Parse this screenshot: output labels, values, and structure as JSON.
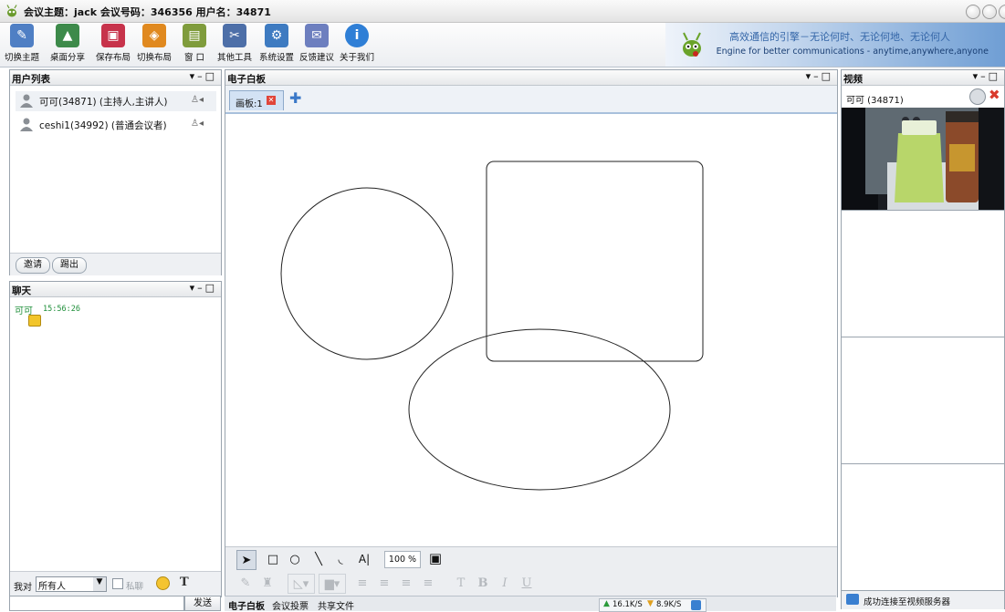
{
  "window": {
    "title": "会议主题：jack 会议号码：346356 用户名：34871"
  },
  "toolbar": {
    "buttons": [
      {
        "label": "切换主题",
        "icon": "theme-icon",
        "color": "#4f7fc4"
      },
      {
        "label": "桌面分享",
        "icon": "desktop-share-icon",
        "color": "#3d8a4a"
      },
      {
        "label": "保存布局",
        "icon": "save-icon",
        "color": "#c7334b"
      },
      {
        "label": "切换布局",
        "icon": "layout-icon",
        "color": "#e0891f"
      },
      {
        "label": "窗 口",
        "icon": "window-icon",
        "color": "#7f9c3c"
      },
      {
        "label": "其他工具",
        "icon": "tools-icon",
        "color": "#4d6fa8"
      },
      {
        "label": "系统设置",
        "icon": "settings-icon",
        "color": "#3e7bc1"
      },
      {
        "label": "反馈建议",
        "icon": "feedback-icon",
        "color": "#6d7fbf"
      },
      {
        "label": "关于我们",
        "icon": "info-icon",
        "color": "#2f7fd6"
      }
    ]
  },
  "banner": {
    "line1": "高效通信的引擎－无论何时、无论何地、无论何人",
    "line2": "Engine for better communications - anytime,anywhere,anyone"
  },
  "users_panel": {
    "title": "用户列表",
    "users": [
      {
        "name": "可可(34871) (主持人,主讲人)"
      },
      {
        "name": "ceshi1(34992) (普通会议者)"
      }
    ],
    "invite_label": "邀请",
    "kick_label": "踢出"
  },
  "chat_panel": {
    "title": "聊天",
    "messages": [
      {
        "sender": "可可",
        "time": "15:56:26"
      }
    ],
    "to_label": "我对",
    "recipient": "所有人",
    "private_label": "私聊",
    "send_label": "发送"
  },
  "whiteboard": {
    "title": "电子白板",
    "tab_label": "画板:1",
    "zoom": "100 %",
    "bottom_tabs": [
      "电子白板",
      "会议投票",
      "共享文件"
    ],
    "net_up": "16.1K/S",
    "net_down": "8.9K/S"
  },
  "video_panel": {
    "title": "视频",
    "user": "可可 (34871)",
    "status": "成功连接至视频服务器"
  }
}
